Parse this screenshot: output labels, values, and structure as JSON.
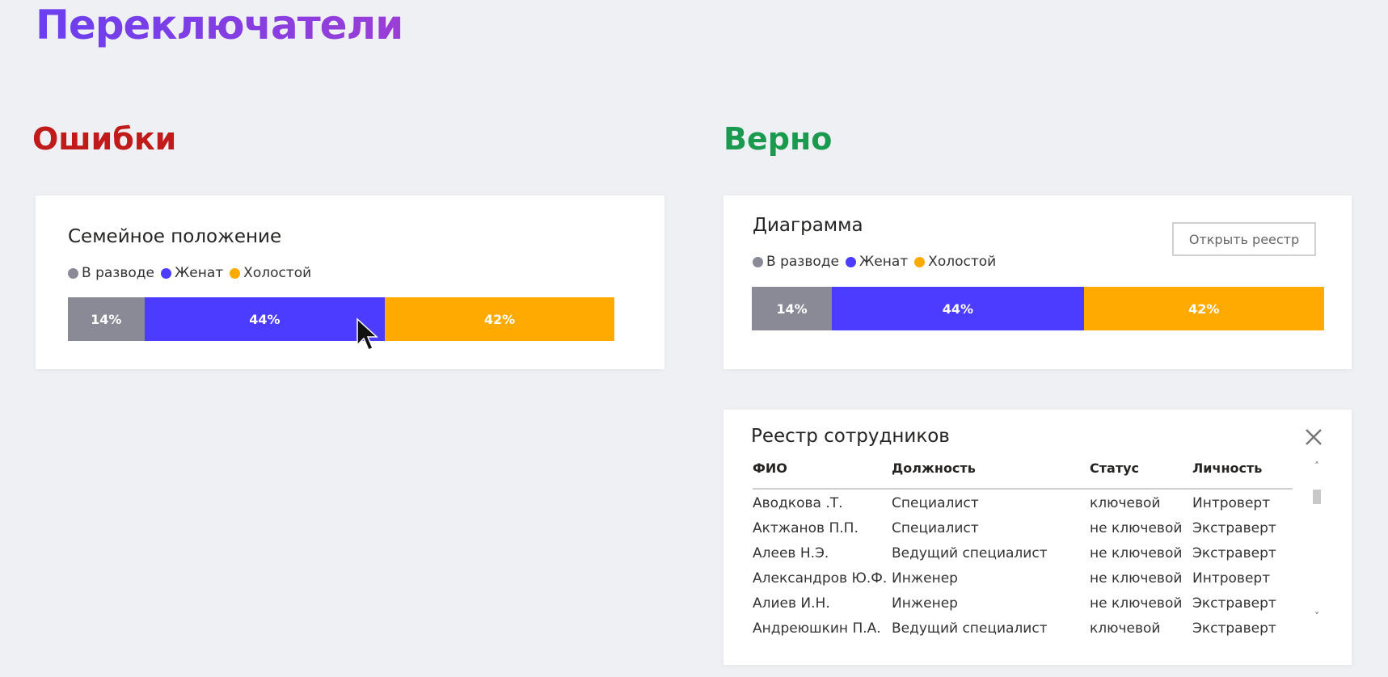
{
  "page": {
    "title": "Переключатели"
  },
  "sections": {
    "errors": "Ошибки",
    "correct": "Верно"
  },
  "colors": {
    "divorced": "#8a8996",
    "married": "#4b3cff",
    "single": "#ffaa00"
  },
  "left_card": {
    "title": "Семейное положение",
    "legend": [
      "В разводе",
      "Женат",
      "Холостой"
    ],
    "segments": [
      {
        "label": "14%",
        "value": 14
      },
      {
        "label": "44%",
        "value": 44
      },
      {
        "label": "42%",
        "value": 42
      }
    ]
  },
  "right_card": {
    "title": "Диаграмма",
    "open_button": "Открыть реестр",
    "legend": [
      "В разводе",
      "Женат",
      "Холостой"
    ],
    "segments": [
      {
        "label": "14%",
        "value": 14
      },
      {
        "label": "44%",
        "value": 44
      },
      {
        "label": "42%",
        "value": 42
      }
    ]
  },
  "registry": {
    "title": "Реестр сотрудников",
    "columns": [
      "ФИО",
      "Должность",
      "Статус",
      "Личность"
    ],
    "rows": [
      [
        "Аводкова .Т.",
        "Специалист",
        "ключевой",
        "Интроверт"
      ],
      [
        "Актжанов П.П.",
        "Специалист",
        "не ключевой",
        "Экстраверт"
      ],
      [
        "Алеев Н.Э.",
        "Ведущий специалист",
        "не ключевой",
        "Экстраверт"
      ],
      [
        "Александров Ю.Ф.",
        "Инженер",
        "не ключевой",
        "Интроверт"
      ],
      [
        "Алиев И.Н.",
        "Инженер",
        "не ключевой",
        "Экстраверт"
      ],
      [
        "Андреюшкин П.А.",
        "Ведущий специалист",
        "ключевой",
        "Экстраверт"
      ]
    ]
  },
  "icons": {
    "close": "close-icon",
    "cursor": "mouse-pointer-icon",
    "scroll_up": "chevron-up-icon",
    "scroll_down": "chevron-down-icon"
  }
}
